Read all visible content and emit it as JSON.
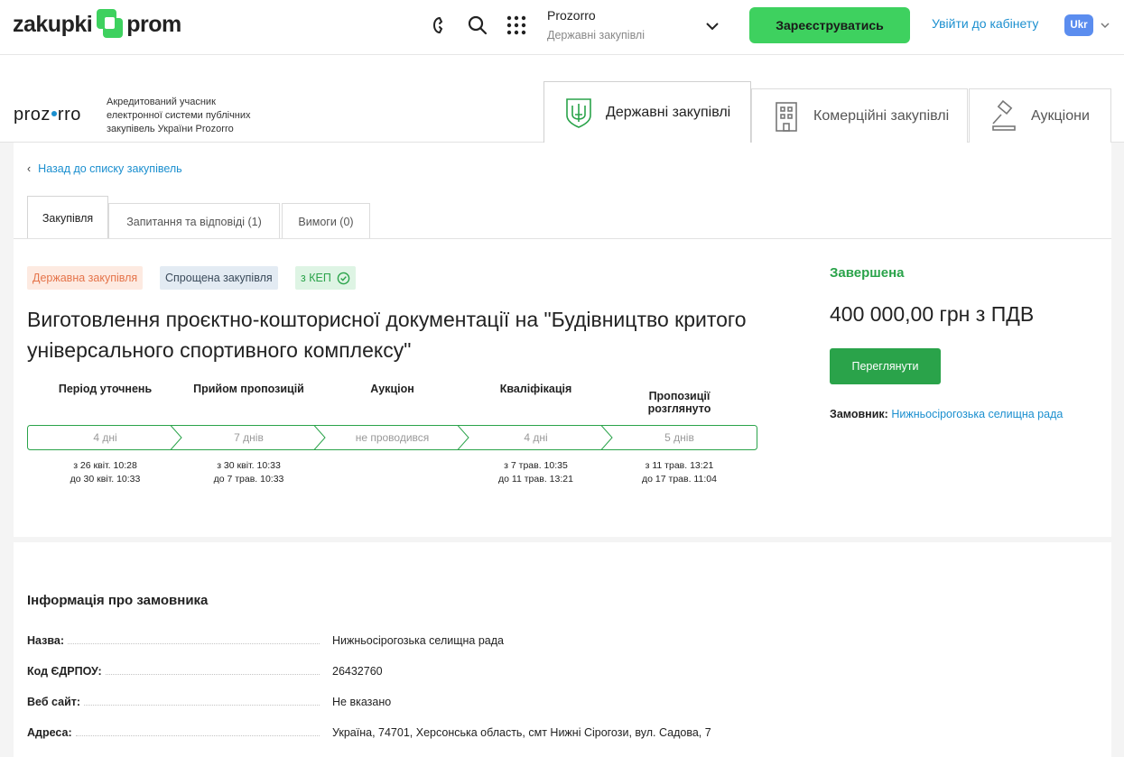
{
  "header": {
    "logo_left": "zakupki",
    "logo_right": "prom",
    "platform_title": "Prozorro",
    "platform_subtitle": "Державні закупівлі",
    "register_label": "Зареєструватись",
    "login_label": "Увійти до кабінету",
    "lang_label": "Ukr"
  },
  "prozorro": {
    "logo_a": "proz",
    "logo_b": "rro",
    "description": "Акредитований учасник електронної системи публічних закупівель України Prozorro",
    "tabs": [
      {
        "label": "Державні закупівлі",
        "icon": "trident-icon"
      },
      {
        "label": "Комерційні закупівлі",
        "icon": "building-icon"
      },
      {
        "label": "Аукціони",
        "icon": "gavel-icon"
      }
    ]
  },
  "tender": {
    "back_label": "Назад до списку закупівель",
    "tabs": [
      "Закупівля",
      "Запитання та відповіді  (1)",
      "Вимоги  (0)"
    ],
    "badges": [
      "Державна закупівля",
      "Спрощена закупівля",
      "з КЕП"
    ],
    "title": "Виготовлення проєктно-кошторисної документації на \"Будівництво критого універсального спортивного комплексу\"",
    "stages": [
      {
        "label": "Період уточнень",
        "duration": "4 дні",
        "from": "з 26 квіт. 10:28",
        "to": "до 30 квіт. 10:33"
      },
      {
        "label": "Прийом пропозицій",
        "duration": "7 днів",
        "from": "з 30 квіт. 10:33",
        "to": "до 7 трав. 10:33"
      },
      {
        "label": "Аукціон",
        "duration": "не проводився",
        "from": "",
        "to": ""
      },
      {
        "label": "Кваліфікація",
        "duration": "4 дні",
        "from": "з 7 трав. 10:35",
        "to": "до 11 трав. 13:21"
      },
      {
        "label_line1": "Пропозиції",
        "label_line2": "розглянуто",
        "duration": "5 днів",
        "from": "з 11 трав. 13:21",
        "to": "до 17 трав. 11:04"
      }
    ],
    "status": "Завершена",
    "amount": "400 000,00 грн з ПДВ",
    "view_label": "Переглянути",
    "customer_key": "Замовник:",
    "customer_value": "Нижньосірогозька селищна рада"
  },
  "customer_info": {
    "heading": "Інформація про замовника",
    "rows": [
      {
        "label": "Назва:",
        "value": "Нижньосірогозька селищна рада"
      },
      {
        "label": "Код ЄДРПОУ:",
        "value": "26432760"
      },
      {
        "label": "Веб сайт:",
        "value": "Не вказано"
      },
      {
        "label": "Адреса:",
        "value": "Україна, 74701, Херсонська область, смт Нижні Сірогози, вул. Садова, 7"
      }
    ]
  },
  "colors": {
    "brand_green": "#3ed15f",
    "status_green": "#2aa34a",
    "link_blue": "#1b8fcf"
  }
}
